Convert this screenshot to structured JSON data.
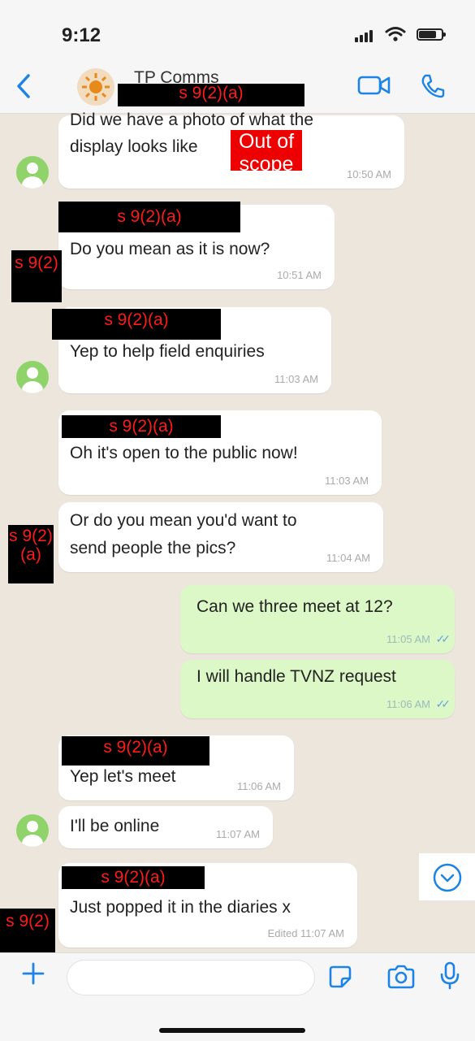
{
  "status": {
    "time": "9:12"
  },
  "header": {
    "title": "TP Comms"
  },
  "redactions": {
    "r1": "s 9(2)(a)",
    "r2": "Out of scope",
    "r3": "s 9(2)(a)",
    "r4": "s 9(2)",
    "r5": "s 9(2)(a)",
    "r6": "s 9(2)(a)",
    "r7": "s 9(2)(a)",
    "r8": "s 9(2)(a)",
    "r9": "s 9(2)(a)",
    "r10": "s 9(2)(a)",
    "r11": "s 9(2)"
  },
  "messages": [
    {
      "text_line1": "Did we have a photo of what the",
      "text_line2": "display looks like",
      "text_line2_end": "?",
      "time": "10:50 AM"
    },
    {
      "text": "Do you mean as it is now?",
      "time": "10:51 AM"
    },
    {
      "text": "Yep to help field enquiries",
      "time": "11:03 AM"
    },
    {
      "text": "Oh it's open to the public now!",
      "time": "11:03 AM"
    },
    {
      "text_line1": "Or do you mean you'd want to",
      "text_line2": "send people the pics?",
      "time": "11:04 AM"
    },
    {
      "text": "Can we three meet at 12?",
      "time": "11:05 AM"
    },
    {
      "text": "I will handle TVNZ request",
      "time": "11:06 AM"
    },
    {
      "text": "Yep let's meet",
      "time": "11:06 AM"
    },
    {
      "text": "I'll be online",
      "time": "11:07 AM"
    },
    {
      "text": "Just popped it in the diaries x",
      "time": "Edited 11:07 AM"
    }
  ],
  "icons": {
    "back": "back-chevron-icon",
    "video": "video-camera-icon",
    "call": "phone-icon",
    "plus": "plus-icon",
    "sticker": "sticker-icon",
    "camera": "camera-icon",
    "mic": "microphone-icon",
    "scroll": "scroll-down-icon"
  },
  "colors": {
    "accent": "#1d84e6",
    "outgoing": "#dcf8c6",
    "redaction_text": "#ff1a1a"
  }
}
